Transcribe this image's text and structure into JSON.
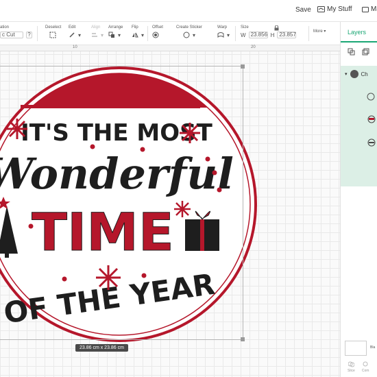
{
  "header": {
    "save_label": "Save",
    "mystuff_label": "My Stuff",
    "make_label": "Ma"
  },
  "toolbar": {
    "operation_label": "ation",
    "operation_value": "c Cut",
    "help": "?",
    "deselect": "Deselect",
    "edit": "Edit",
    "align": "Align",
    "arrange": "Arrange",
    "flip": "Flip",
    "offset": "Offset",
    "linetype": "Create Sticker",
    "warp": "Warp",
    "size": "Size",
    "w_label": "W",
    "w_value": "23.856",
    "h_label": "H",
    "h_value": "23.857",
    "more": "More"
  },
  "ruler": {
    "t1": "10",
    "t2": "20"
  },
  "canvas": {
    "dimension_label": "23.86  cm x 23.86  cm"
  },
  "design": {
    "line1": "IT'S THE MOST",
    "line2": "Wonderful",
    "line3": "TIME",
    "line4": "OF THE YEAR",
    "red": "#b5172b",
    "dark": "#1e1e1e"
  },
  "panel": {
    "tab_label": "Layers",
    "group_label": "Ch",
    "blank_label": "Bla",
    "tool1": "Slice",
    "tool2": "Com"
  },
  "colors": {
    "accent": "#1aa774",
    "group_bg": "#dcefe6"
  }
}
